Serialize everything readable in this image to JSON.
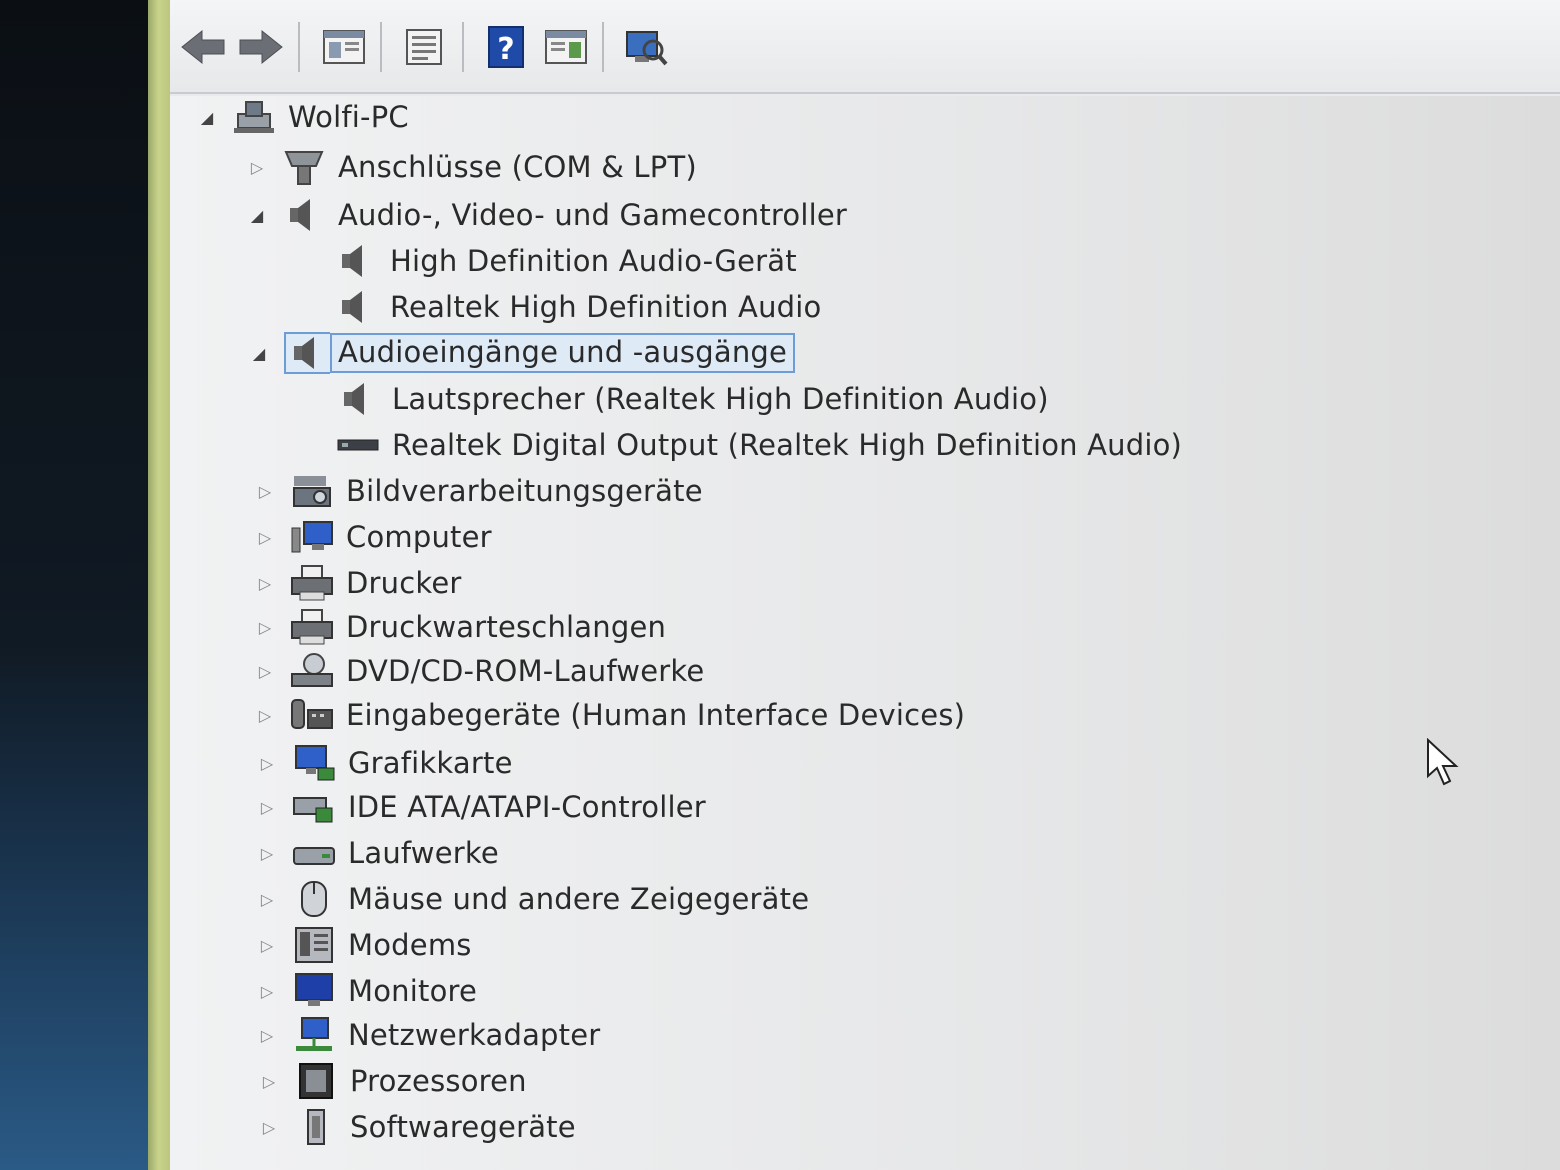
{
  "toolbar": {
    "buttons": [
      {
        "name": "back-button",
        "icon": "back-arrow-icon"
      },
      {
        "name": "forward-button",
        "icon": "forward-arrow-icon"
      },
      {
        "name": "show-hide-console-tree-button",
        "icon": "console-tree-icon"
      },
      {
        "name": "properties-button",
        "icon": "properties-icon"
      },
      {
        "name": "help-button",
        "icon": "help-icon"
      },
      {
        "name": "action-pane-button",
        "icon": "action-pane-icon"
      },
      {
        "name": "scan-hardware-button",
        "icon": "scan-hardware-icon"
      }
    ]
  },
  "tree": {
    "root": {
      "label": "Wolfi-PC",
      "icon": "computer-root-icon",
      "expanded": true
    },
    "categories": [
      {
        "label": "Anschlüsse (COM & LPT)",
        "icon": "port-icon",
        "expanded": false
      },
      {
        "label": "Audio-, Video- und Gamecontroller",
        "icon": "speaker-icon",
        "expanded": true,
        "children": [
          {
            "label": "High Definition Audio-Gerät",
            "icon": "speaker-icon"
          },
          {
            "label": "Realtek High Definition Audio",
            "icon": "speaker-icon"
          }
        ]
      },
      {
        "label": "Audioeingänge und -ausgänge",
        "icon": "speaker-icon",
        "expanded": true,
        "selected": true,
        "children": [
          {
            "label": "Lautsprecher (Realtek High Definition Audio)",
            "icon": "speaker-icon"
          },
          {
            "label": "Realtek Digital Output (Realtek High Definition Audio)",
            "icon": "digital-output-icon"
          }
        ]
      },
      {
        "label": "Bildverarbeitungsgeräte",
        "icon": "camera-icon",
        "expanded": false
      },
      {
        "label": "Computer",
        "icon": "computer-icon",
        "expanded": false
      },
      {
        "label": "Drucker",
        "icon": "printer-icon",
        "expanded": false
      },
      {
        "label": "Druckwarteschlangen",
        "icon": "printer-icon",
        "expanded": false
      },
      {
        "label": "DVD/CD-ROM-Laufwerke",
        "icon": "dvd-drive-icon",
        "expanded": false
      },
      {
        "label": "Eingabegeräte (Human Interface Devices)",
        "icon": "hid-icon",
        "expanded": false
      },
      {
        "label": "Grafikkarte",
        "icon": "display-adapter-icon",
        "expanded": false
      },
      {
        "label": "IDE ATA/ATAPI-Controller",
        "icon": "ide-controller-icon",
        "expanded": false
      },
      {
        "label": "Laufwerke",
        "icon": "disk-drive-icon",
        "expanded": false
      },
      {
        "label": "Mäuse und andere Zeigegeräte",
        "icon": "mouse-icon",
        "expanded": false
      },
      {
        "label": "Modems",
        "icon": "modem-icon",
        "expanded": false
      },
      {
        "label": "Monitore",
        "icon": "monitor-icon",
        "expanded": false
      },
      {
        "label": "Netzwerkadapter",
        "icon": "network-adapter-icon",
        "expanded": false
      },
      {
        "label": "Prozessoren",
        "icon": "processor-icon",
        "expanded": false
      },
      {
        "label": "Softwaregeräte",
        "icon": "software-device-icon",
        "expanded": false
      }
    ]
  },
  "colors": {
    "selection_border": "#6d9cd6",
    "selection_fill": "#dfeaf7",
    "text": "#2a2a2a"
  }
}
